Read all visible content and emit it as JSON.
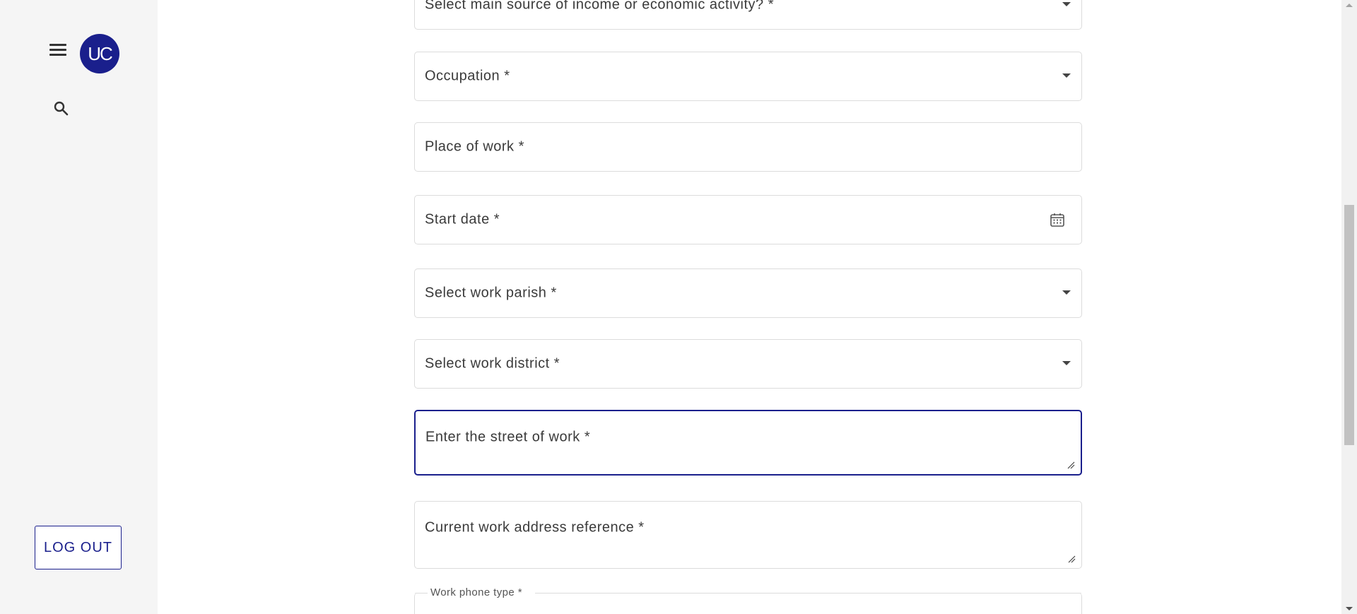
{
  "sidebar": {
    "avatar_initials": "UC",
    "logout_label": "LOG OUT",
    "menu_icon": "hamburger-menu-icon",
    "search_icon": "search-icon"
  },
  "form": {
    "income_source": {
      "label": "Select main source of income or economic activity? *"
    },
    "occupation": {
      "label": "Occupation *"
    },
    "place_of_work": {
      "label": "Place of work *"
    },
    "start_date": {
      "label": "Start date *"
    },
    "work_parish": {
      "label": "Select work parish *"
    },
    "work_district": {
      "label": "Select work district *"
    },
    "street_of_work": {
      "label": "Enter the street of work *"
    },
    "work_address_reference": {
      "label": "Current work address reference *"
    },
    "work_phone_type": {
      "label": "Work phone type *"
    }
  },
  "colors": {
    "brand": "#1a1f8c",
    "sidebar_bg": "#f5f5f5",
    "field_border": "#dcdcdc"
  }
}
